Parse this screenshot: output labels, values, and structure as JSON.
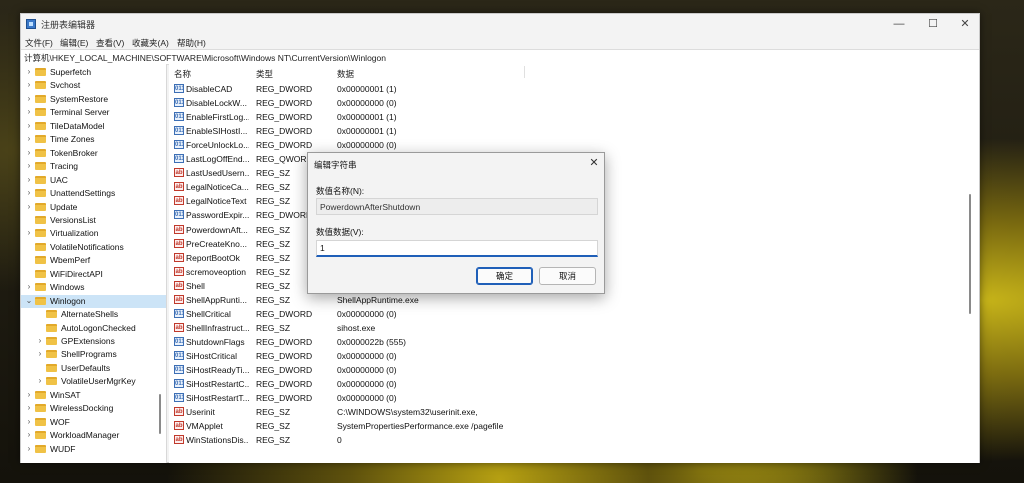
{
  "window": {
    "title": "注册表编辑器",
    "minimize_glyph": "—",
    "maximize_glyph": "☐",
    "close_glyph": "✕"
  },
  "menu": [
    "文件(F)",
    "编辑(E)",
    "查看(V)",
    "收藏夹(A)",
    "帮助(H)"
  ],
  "address": "计算机\\HKEY_LOCAL_MACHINE\\SOFTWARE\\Microsoft\\Windows NT\\CurrentVersion\\Winlogon",
  "tree": [
    {
      "label": "Superfetch",
      "level": 0,
      "expander": "›",
      "selected": false
    },
    {
      "label": "Svchost",
      "level": 0,
      "expander": "›",
      "selected": false
    },
    {
      "label": "SystemRestore",
      "level": 0,
      "expander": "›",
      "selected": false
    },
    {
      "label": "Terminal Server",
      "level": 0,
      "expander": "›",
      "selected": false
    },
    {
      "label": "TileDataModel",
      "level": 0,
      "expander": "›",
      "selected": false
    },
    {
      "label": "Time Zones",
      "level": 0,
      "expander": "›",
      "selected": false
    },
    {
      "label": "TokenBroker",
      "level": 0,
      "expander": "›",
      "selected": false
    },
    {
      "label": "Tracing",
      "level": 0,
      "expander": "›",
      "selected": false
    },
    {
      "label": "UAC",
      "level": 0,
      "expander": "›",
      "selected": false
    },
    {
      "label": "UnattendSettings",
      "level": 0,
      "expander": "›",
      "selected": false
    },
    {
      "label": "Update",
      "level": 0,
      "expander": "›",
      "selected": false
    },
    {
      "label": "VersionsList",
      "level": 0,
      "expander": "",
      "selected": false
    },
    {
      "label": "Virtualization",
      "level": 0,
      "expander": "›",
      "selected": false
    },
    {
      "label": "VolatileNotifications",
      "level": 0,
      "expander": "",
      "selected": false
    },
    {
      "label": "WbemPerf",
      "level": 0,
      "expander": "",
      "selected": false
    },
    {
      "label": "WiFiDirectAPI",
      "level": 0,
      "expander": "",
      "selected": false
    },
    {
      "label": "Windows",
      "level": 0,
      "expander": "›",
      "selected": false
    },
    {
      "label": "Winlogon",
      "level": 0,
      "expander": "⌄",
      "selected": true
    },
    {
      "label": "AlternateShells",
      "level": 1,
      "expander": "",
      "selected": false
    },
    {
      "label": "AutoLogonChecked",
      "level": 1,
      "expander": "",
      "selected": false
    },
    {
      "label": "GPExtensions",
      "level": 1,
      "expander": "›",
      "selected": false
    },
    {
      "label": "ShellPrograms",
      "level": 1,
      "expander": "›",
      "selected": false
    },
    {
      "label": "UserDefaults",
      "level": 1,
      "expander": "",
      "selected": false
    },
    {
      "label": "VolatileUserMgrKey",
      "level": 1,
      "expander": "›",
      "selected": false
    },
    {
      "label": "WinSAT",
      "level": 0,
      "expander": "›",
      "selected": false
    },
    {
      "label": "WirelessDocking",
      "level": 0,
      "expander": "›",
      "selected": false
    },
    {
      "label": "WOF",
      "level": 0,
      "expander": "›",
      "selected": false
    },
    {
      "label": "WorkloadManager",
      "level": 0,
      "expander": "›",
      "selected": false
    },
    {
      "label": "WUDF",
      "level": 0,
      "expander": "›",
      "selected": false
    }
  ],
  "values_header": {
    "name": "名称",
    "type": "类型",
    "data": "数据"
  },
  "values": [
    {
      "name": "DisableCAD",
      "type": "REG_DWORD",
      "data": "0x00000001 (1)",
      "icon": "dword"
    },
    {
      "name": "DisableLockW...",
      "type": "REG_DWORD",
      "data": "0x00000000 (0)",
      "icon": "dword"
    },
    {
      "name": "EnableFirstLog...",
      "type": "REG_DWORD",
      "data": "0x00000001 (1)",
      "icon": "dword"
    },
    {
      "name": "EnableSIHostI...",
      "type": "REG_DWORD",
      "data": "0x00000001 (1)",
      "icon": "dword"
    },
    {
      "name": "ForceUnlockLo...",
      "type": "REG_DWORD",
      "data": "0x00000000 (0)",
      "icon": "dword"
    },
    {
      "name": "LastLogOffEnd...",
      "type": "REG_QWORD",
      "data": "",
      "icon": "dword"
    },
    {
      "name": "LastUsedUsern...",
      "type": "REG_SZ",
      "data": "",
      "icon": "sz"
    },
    {
      "name": "LegalNoticeCa...",
      "type": "REG_SZ",
      "data": "",
      "icon": "sz"
    },
    {
      "name": "LegalNoticeText",
      "type": "REG_SZ",
      "data": "",
      "icon": "sz"
    },
    {
      "name": "PasswordExpir...",
      "type": "REG_DWORD",
      "data": "",
      "icon": "dword"
    },
    {
      "name": "PowerdownAft...",
      "type": "REG_SZ",
      "data": "",
      "icon": "sz"
    },
    {
      "name": "PreCreateKno...",
      "type": "REG_SZ",
      "data": "",
      "icon": "sz"
    },
    {
      "name": "ReportBootOk",
      "type": "REG_SZ",
      "data": "",
      "icon": "sz"
    },
    {
      "name": "scremoveoption",
      "type": "REG_SZ",
      "data": "",
      "icon": "sz"
    },
    {
      "name": "Shell",
      "type": "REG_SZ",
      "data": "",
      "icon": "sz"
    },
    {
      "name": "ShellAppRunti...",
      "type": "REG_SZ",
      "data": "ShellAppRuntime.exe",
      "icon": "sz"
    },
    {
      "name": "ShellCritical",
      "type": "REG_DWORD",
      "data": "0x00000000 (0)",
      "icon": "dword"
    },
    {
      "name": "ShellInfrastruct...",
      "type": "REG_SZ",
      "data": "sihost.exe",
      "icon": "sz"
    },
    {
      "name": "ShutdownFlags",
      "type": "REG_DWORD",
      "data": "0x0000022b (555)",
      "icon": "dword"
    },
    {
      "name": "SiHostCritical",
      "type": "REG_DWORD",
      "data": "0x00000000 (0)",
      "icon": "dword"
    },
    {
      "name": "SiHostReadyTi...",
      "type": "REG_DWORD",
      "data": "0x00000000 (0)",
      "icon": "dword"
    },
    {
      "name": "SiHostRestartC...",
      "type": "REG_DWORD",
      "data": "0x00000000 (0)",
      "icon": "dword"
    },
    {
      "name": "SiHostRestartT...",
      "type": "REG_DWORD",
      "data": "0x00000000 (0)",
      "icon": "dword"
    },
    {
      "name": "Userinit",
      "type": "REG_SZ",
      "data": "C:\\WINDOWS\\system32\\userinit.exe,",
      "icon": "sz"
    },
    {
      "name": "VMApplet",
      "type": "REG_SZ",
      "data": "SystemPropertiesPerformance.exe /pagefile",
      "icon": "sz"
    },
    {
      "name": "WinStationsDis...",
      "type": "REG_SZ",
      "data": "0",
      "icon": "sz"
    }
  ],
  "dialog": {
    "title": "编辑字符串",
    "close_glyph": "✕",
    "name_label": "数值名称(N):",
    "name_value": "PowerdownAfterShutdown",
    "data_label": "数值数据(V):",
    "data_value": "1",
    "ok_label": "确定",
    "cancel_label": "取消"
  }
}
